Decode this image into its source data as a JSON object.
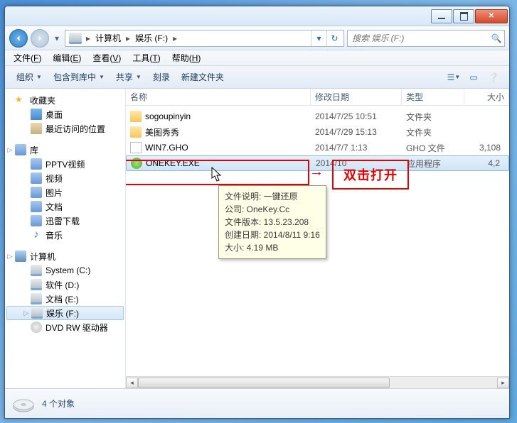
{
  "breadcrumb": {
    "seg1": "计算机",
    "seg2": "娱乐 (F:)"
  },
  "search": {
    "placeholder": "搜索 娱乐 (F:)"
  },
  "menubar": [
    {
      "label": "文件",
      "key": "F"
    },
    {
      "label": "编辑",
      "key": "E"
    },
    {
      "label": "查看",
      "key": "V"
    },
    {
      "label": "工具",
      "key": "T"
    },
    {
      "label": "帮助",
      "key": "H"
    }
  ],
  "toolbar": {
    "organize": "组织",
    "include": "包含到库中",
    "share": "共享",
    "burn": "刻录",
    "newfolder": "新建文件夹"
  },
  "sidebar": {
    "favorites": {
      "label": "收藏夹",
      "items": [
        "桌面",
        "最近访问的位置"
      ]
    },
    "libraries": {
      "label": "库",
      "items": [
        "PPTV视频",
        "视频",
        "图片",
        "文档",
        "迅雷下载",
        "音乐"
      ]
    },
    "computer": {
      "label": "计算机",
      "items": [
        "System (C:)",
        "软件 (D:)",
        "文档 (E:)",
        "娱乐 (F:)",
        "DVD RW 驱动器"
      ]
    }
  },
  "columns": {
    "name": "名称",
    "date": "修改日期",
    "type": "类型",
    "size": "大小"
  },
  "files": [
    {
      "name": "sogoupinyin",
      "date": "2014/7/25 10:51",
      "type": "文件夹",
      "size": "",
      "icon": "folder"
    },
    {
      "name": "美图秀秀",
      "date": "2014/7/29 15:13",
      "type": "文件夹",
      "size": "",
      "icon": "folder"
    },
    {
      "name": "WIN7.GHO",
      "date": "2014/7/7 1:13",
      "type": "GHO 文件",
      "size": "3,108",
      "icon": "file"
    },
    {
      "name": "ONEKEY.EXE",
      "date": "2014/10",
      "type": "应用程序",
      "size": "4,2",
      "icon": "exe",
      "selected": true
    }
  ],
  "tooltip": {
    "line1": "文件说明: 一键还原",
    "line2": "公司: OneKey.Cc",
    "line3": "文件版本: 13.5.23.208",
    "line4": "创建日期: 2014/8/11 9:16",
    "line5": "大小: 4.19 MB"
  },
  "annotation": {
    "label": "双击打开"
  },
  "statusbar": {
    "count": "4 个对象"
  }
}
